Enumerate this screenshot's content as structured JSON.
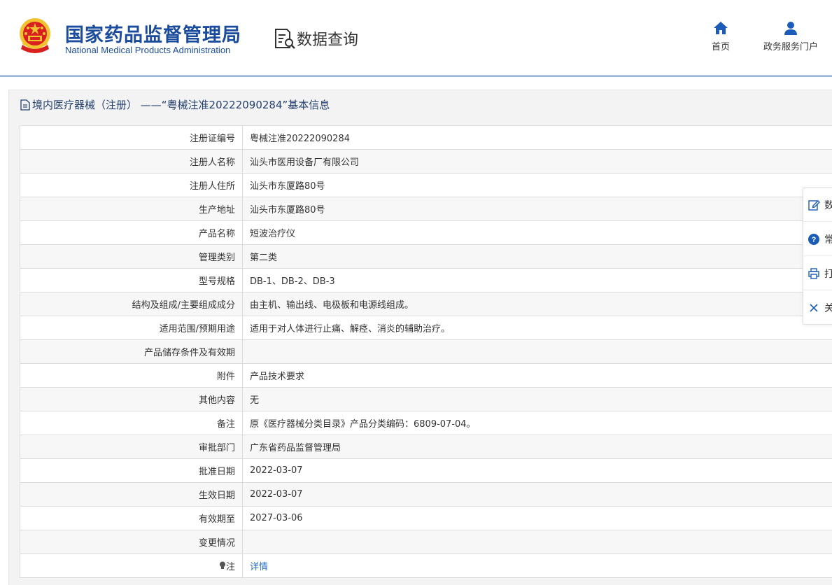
{
  "header": {
    "logo_cn": "国家药品监督管理局",
    "logo_en": "National Medical Products Administration",
    "query_label": "数据查询",
    "nav": {
      "home": "首页",
      "portal": "政务服务门户"
    }
  },
  "panel": {
    "title": "境内医疗器械（注册） ——“粤械注准20222090284”基本信息"
  },
  "rows": [
    {
      "label": "注册证编号",
      "value": "粤械注准20222090284"
    },
    {
      "label": "注册人名称",
      "value": "汕头市医用设备厂有限公司"
    },
    {
      "label": "注册人住所",
      "value": "汕头市东厦路80号"
    },
    {
      "label": "生产地址",
      "value": "汕头市东厦路80号"
    },
    {
      "label": "产品名称",
      "value": "短波治疗仪"
    },
    {
      "label": "管理类别",
      "value": "第二类"
    },
    {
      "label": "型号规格",
      "value": "DB-1、DB-2、DB-3"
    },
    {
      "label": "结构及组成/主要组成成分",
      "value": "由主机、输出线、电极板和电源线组成。"
    },
    {
      "label": "适用范围/预期用途",
      "value": "适用于对人体进行止痛、解痉、消炎的辅助治疗。"
    },
    {
      "label": "产品储存条件及有效期",
      "value": ""
    },
    {
      "label": "附件",
      "value": "产品技术要求"
    },
    {
      "label": "其他内容",
      "value": "无"
    },
    {
      "label": "备注",
      "value": "原《医疗器械分类目录》产品分类编码：6809-07-04。"
    },
    {
      "label": "审批部门",
      "value": "广东省药品监督管理局"
    },
    {
      "label": "批准日期",
      "value": "2022-03-07"
    },
    {
      "label": "生效日期",
      "value": "2022-03-07"
    },
    {
      "label": "有效期至",
      "value": "2027-03-06"
    },
    {
      "label": "变更情况",
      "value": ""
    }
  ],
  "note_row": {
    "label": "注",
    "link": "详情"
  },
  "float_panel": [
    {
      "icon": "edit-icon",
      "label": "数"
    },
    {
      "icon": "help-icon",
      "label": "常"
    },
    {
      "icon": "print-icon",
      "label": "打"
    },
    {
      "icon": "close-icon",
      "label": "关"
    }
  ],
  "colors": {
    "brand": "#1a4b9c",
    "link": "#2a6fc9",
    "title": "#23406f"
  }
}
